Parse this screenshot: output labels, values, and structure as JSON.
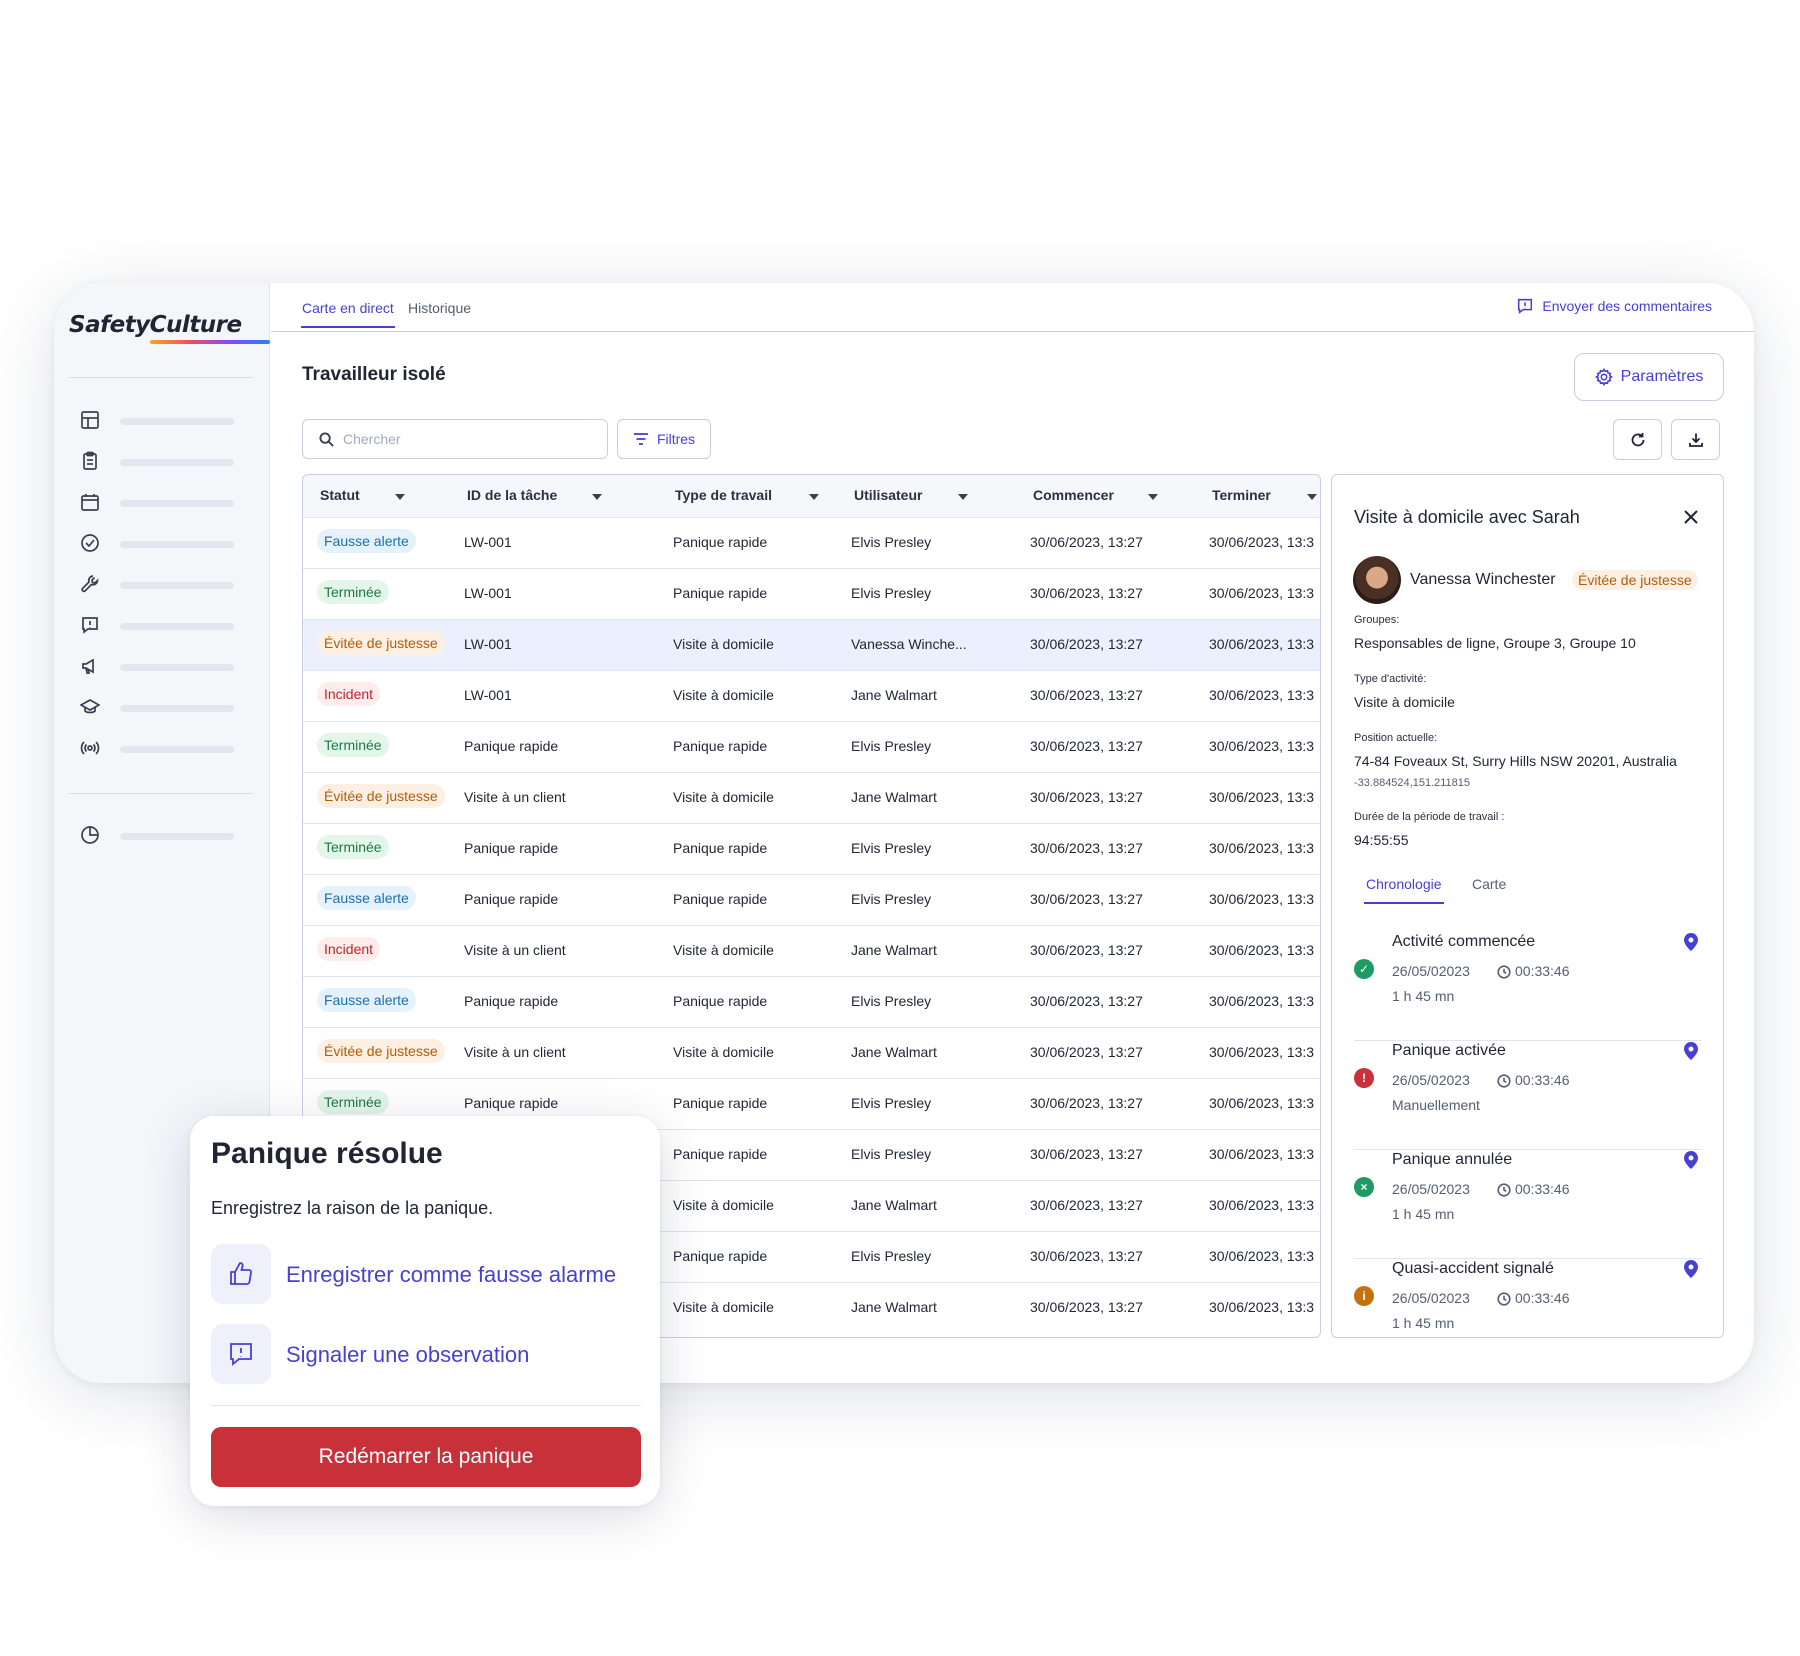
{
  "brand": {
    "logo": "SafetyCulture"
  },
  "top_tabs": [
    {
      "label": "Carte en direct",
      "active": true
    },
    {
      "label": "Historique",
      "active": false
    }
  ],
  "feedback": {
    "label": "Envoyer des commentaires",
    "icon": "feedback-icon"
  },
  "sidebar": {
    "icons": [
      "dashboard-icon",
      "clipboard-icon",
      "calendar-icon",
      "check-circle-icon",
      "wrench-icon",
      "alert-bubble-icon",
      "megaphone-icon",
      "graduation-cap-icon",
      "broadcast-icon",
      "pie-chart-icon"
    ]
  },
  "page": {
    "title": "Travailleur isolé",
    "settings_label": "Paramètres",
    "search_placeholder": "Chercher",
    "filters_label": "Filtres"
  },
  "table": {
    "columns": [
      "Statut",
      "ID de la tâche",
      "Type de travail",
      "Utilisateur",
      "Commencer",
      "Terminer"
    ],
    "rows": [
      {
        "status": "Fausse alerte",
        "kind": "fausse",
        "id": "LW-001",
        "type": "Panique rapide",
        "user": "Elvis Presley",
        "start": "30/06/2023, 13:27",
        "end": "30/06/2023, 13:3"
      },
      {
        "status": "Terminée",
        "kind": "terminee",
        "id": "LW-001",
        "type": "Panique rapide",
        "user": "Elvis Presley",
        "start": "30/06/2023, 13:27",
        "end": "30/06/2023, 13:3"
      },
      {
        "status": "Évitée de justesse",
        "kind": "evitee",
        "id": "LW-001",
        "type": "Visite à domicile",
        "user": "Vanessa Winche...",
        "start": "30/06/2023, 13:27",
        "end": "30/06/2023, 13:3",
        "selected": true
      },
      {
        "status": "Incident",
        "kind": "incident",
        "id": "LW-001",
        "type": "Visite à domicile",
        "user": "Jane Walmart",
        "start": "30/06/2023, 13:27",
        "end": "30/06/2023, 13:3"
      },
      {
        "status": "Terminée",
        "kind": "terminee",
        "id": "Panique rapide",
        "type": "Panique rapide",
        "user": "Elvis Presley",
        "start": "30/06/2023, 13:27",
        "end": "30/06/2023, 13:3"
      },
      {
        "status": "Évitée de justesse",
        "kind": "evitee",
        "id": "Visite à un client",
        "type": "Visite à domicile",
        "user": "Jane Walmart",
        "start": "30/06/2023, 13:27",
        "end": "30/06/2023, 13:3"
      },
      {
        "status": "Terminée",
        "kind": "terminee",
        "id": "Panique rapide",
        "type": "Panique rapide",
        "user": "Elvis Presley",
        "start": "30/06/2023, 13:27",
        "end": "30/06/2023, 13:3"
      },
      {
        "status": "Fausse alerte",
        "kind": "fausse",
        "id": "Panique rapide",
        "type": "Panique rapide",
        "user": "Elvis Presley",
        "start": "30/06/2023, 13:27",
        "end": "30/06/2023, 13:3"
      },
      {
        "status": "Incident",
        "kind": "incident",
        "id": "Visite à un client",
        "type": "Visite à domicile",
        "user": "Jane Walmart",
        "start": "30/06/2023, 13:27",
        "end": "30/06/2023, 13:3"
      },
      {
        "status": "Fausse alerte",
        "kind": "fausse",
        "id": "Panique rapide",
        "type": "Panique rapide",
        "user": "Elvis Presley",
        "start": "30/06/2023, 13:27",
        "end": "30/06/2023, 13:3"
      },
      {
        "status": "Évitée de justesse",
        "kind": "evitee",
        "id": "Visite à un client",
        "type": "Visite à domicile",
        "user": "Jane Walmart",
        "start": "30/06/2023, 13:27",
        "end": "30/06/2023, 13:3"
      },
      {
        "status": "Terminée",
        "kind": "terminee",
        "id": "Panique rapide",
        "type": "Panique rapide",
        "user": "Elvis Presley",
        "start": "30/06/2023, 13:27",
        "end": "30/06/2023, 13:3"
      },
      {
        "status": "",
        "kind": "",
        "id": "",
        "type": "Panique rapide",
        "user": "Elvis Presley",
        "start": "30/06/2023, 13:27",
        "end": "30/06/2023, 13:3"
      },
      {
        "status": "",
        "kind": "",
        "id": "",
        "type": "Visite à domicile",
        "user": "Jane Walmart",
        "start": "30/06/2023, 13:27",
        "end": "30/06/2023, 13:3"
      },
      {
        "status": "",
        "kind": "",
        "id": "",
        "type": "Panique rapide",
        "user": "Elvis Presley",
        "start": "30/06/2023, 13:27",
        "end": "30/06/2023, 13:3"
      },
      {
        "status": "",
        "kind": "",
        "id": "",
        "type": "Visite à domicile",
        "user": "Jane Walmart",
        "start": "30/06/2023, 13:27",
        "end": "30/06/2023, 13:3"
      }
    ]
  },
  "panel": {
    "title": "Visite à domicile avec Sarah",
    "user": "Vanessa Winchester",
    "status": "Évitée de justesse",
    "groups_label": "Groupes:",
    "groups_value": "Responsables de ligne, Groupe 3, Groupe 10",
    "activity_label": "Type d'activité:",
    "activity_value": "Visite à domicile",
    "position_label": "Position actuelle:",
    "position_value": "74-84 Foveaux St, Surry Hills NSW 20201, Australia",
    "coords": "-33.884524,151.211815",
    "duration_label": "Durée de la période de travail :",
    "duration_value": "94:55:55",
    "tabs": [
      {
        "label": "Chronologie",
        "active": true
      },
      {
        "label": "Carte",
        "active": false
      }
    ],
    "events": [
      {
        "title": "Activité commencée",
        "date": "26/05/02023",
        "time": "00:33:46",
        "sub": "1 h 45 mn",
        "icon": "check-icon",
        "color": "#1e9b63",
        "glyph": "✓"
      },
      {
        "title": "Panique activée",
        "date": "26/05/02023",
        "time": "00:33:46",
        "sub": "Manuellement",
        "icon": "alert-icon",
        "color": "#c8303a",
        "glyph": "!"
      },
      {
        "title": "Panique annulée",
        "date": "26/05/02023",
        "time": "00:33:46",
        "sub": "1 h 45 mn",
        "icon": "cancel-icon",
        "color": "#1e9b63",
        "glyph": "×"
      },
      {
        "title": "Quasi-accident signalé",
        "date": "26/05/02023",
        "time": "00:33:46",
        "sub": "1 h 45 mn",
        "icon": "info-icon",
        "color": "#c4720e",
        "glyph": "i"
      }
    ]
  },
  "card": {
    "title": "Panique résolue",
    "subtitle": "Enregistrez la raison de la panique.",
    "option_false_alarm": "Enregistrer comme fausse alarme",
    "option_observation": "Signaler une observation",
    "restart_label": "Redémarrer la panique"
  },
  "colors": {
    "accent": "#4740d4",
    "danger": "#c8303a"
  }
}
